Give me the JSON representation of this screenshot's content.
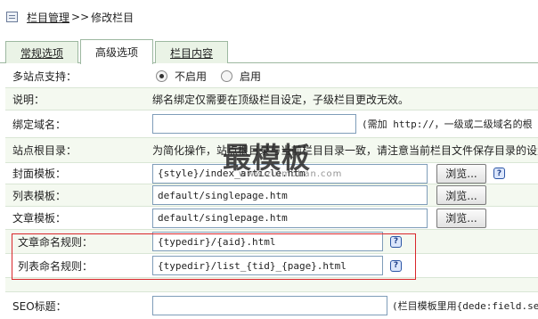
{
  "breadcrumb": {
    "section": "栏目管理",
    "separator": ">>",
    "current": "修改栏目"
  },
  "tabs": [
    {
      "label": "常规选项",
      "active": false
    },
    {
      "label": "高级选项",
      "active": true
    },
    {
      "label": "栏目内容",
      "active": false
    }
  ],
  "fields": {
    "multisite": {
      "label": "多站点支持：",
      "options": [
        "不启用",
        "启用"
      ],
      "selected": "不启用"
    },
    "note": {
      "label": "说明：",
      "text": "绑名绑定仅需要在顶级栏目设定，子级栏目更改无效。"
    },
    "bind_domain": {
      "label": "绑定域名：",
      "value": "",
      "hint": "(需加 http://，一级或二级域名的根"
    },
    "site_root": {
      "label": "站点根目录：",
      "text": "为简化操作，站点根目录与当前栏目目录一致，请注意当前栏目文件保存目录的设置"
    },
    "cover_template": {
      "label": "封面模板：",
      "value": "{style}/index_article.htm",
      "button": "浏览..."
    },
    "list_template": {
      "label": "列表模板：",
      "value": "default/singlepage.htm",
      "button": "浏览..."
    },
    "article_template": {
      "label": "文章模板：",
      "value": "default/singlepage.htm",
      "button": "浏览..."
    },
    "article_naming": {
      "label": "文章命名规则：",
      "value": "{typedir}/{aid}.html"
    },
    "list_naming": {
      "label": "列表命名规则：",
      "value": "{typedir}/list_{tid}_{page}.html"
    },
    "seo_title": {
      "label": "SEO标题：",
      "value": "",
      "hint": "(栏目模板里用{dede:field.seo"
    }
  },
  "watermark": {
    "text": "最模板",
    "url": "www.zuimoban.com"
  },
  "icons": {
    "help": "question-mark-icon",
    "home": "home-icon"
  },
  "colors": {
    "row_shade": "#f4f9f0",
    "highlight_border": "#d9262b",
    "tab_border": "#9db8a0"
  }
}
